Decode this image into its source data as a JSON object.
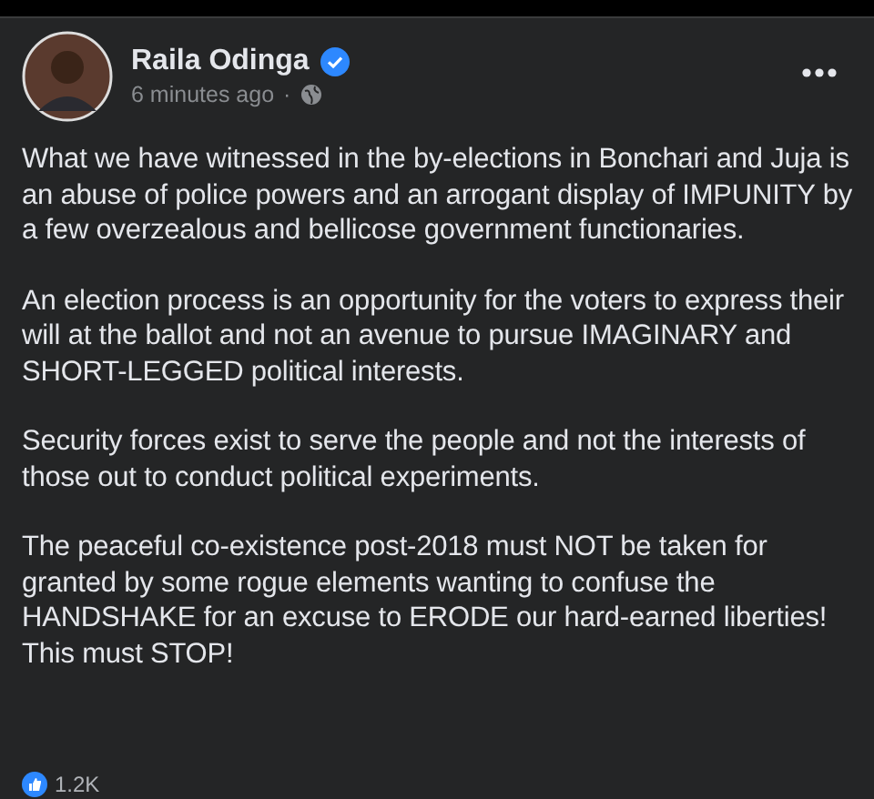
{
  "post": {
    "author": "Raila Odinga",
    "verified": true,
    "time": "6 minutes ago",
    "separator": "·",
    "paragraphs": [
      "What we have witnessed in the by-elections in Bonchari and Juja is an abuse of police powers and an arrogant display of IMPUNITY by a few overzealous and bellicose government functionaries.",
      "An election process is an opportunity for the voters to express their will at the ballot and not an avenue to pursue IMAGINARY and SHORT-LEGGED political interests.",
      "Security forces exist to serve the people and not the interests of those out to conduct political experiments.",
      "The peaceful co-existence post-2018 must NOT be taken for granted by some rogue elements wanting to confuse the HANDSHAKE for an excuse to ERODE our hard-earned liberties!\nThis must STOP!"
    ],
    "reactions": {
      "count": "1.2K"
    }
  }
}
